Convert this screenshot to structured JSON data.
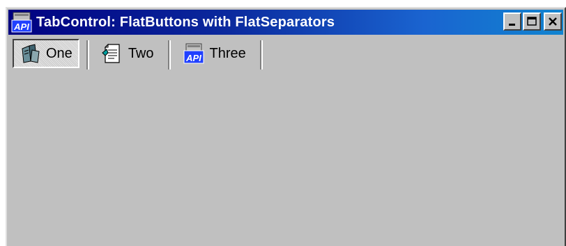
{
  "window": {
    "title": "TabControl: FlatButtons with FlatSeparators",
    "app_icon": "api-app-icon"
  },
  "caption_buttons": {
    "minimize": "minimize-icon",
    "maximize": "maximize-icon",
    "close": "close-icon"
  },
  "tabs": [
    {
      "label": "One",
      "icon": "books-icon",
      "selected": true
    },
    {
      "label": "Two",
      "icon": "document-icon",
      "selected": false
    },
    {
      "label": "Three",
      "icon": "api-icon",
      "selected": false
    }
  ],
  "colors": {
    "titlebar_start": "#000080",
    "titlebar_end": "#1084d0",
    "face": "#c0c0c0"
  }
}
